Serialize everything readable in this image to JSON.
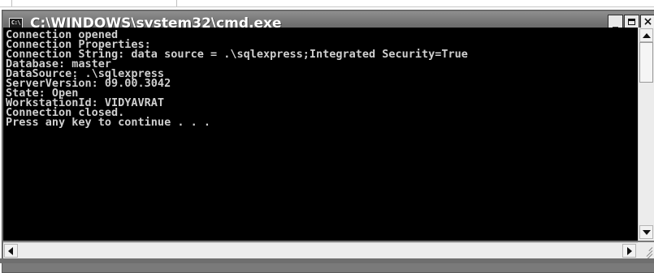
{
  "window": {
    "title": "C:\\WINDOWS\\system32\\cmd.exe",
    "icon_label": "C:\\",
    "icon_name": "console-icon",
    "controls": {
      "minimize": "_",
      "close": "×"
    }
  },
  "console": {
    "lines": [
      "Connection opened",
      "Connection Properties:",
      "Connection String: data source = .\\sqlexpress;Integrated Security=True",
      "Database: master",
      "DataSource: .\\sqlexpress",
      "ServerVersion: 09.00.3042",
      "State: Open",
      "WorkstationId: VIDYAVRAT",
      "Connection closed.",
      "Press any key to continue . . ."
    ]
  },
  "colors": {
    "console_background": "#000000",
    "console_text": "#cfcfcf",
    "titlebar": "#7a7a7a"
  }
}
